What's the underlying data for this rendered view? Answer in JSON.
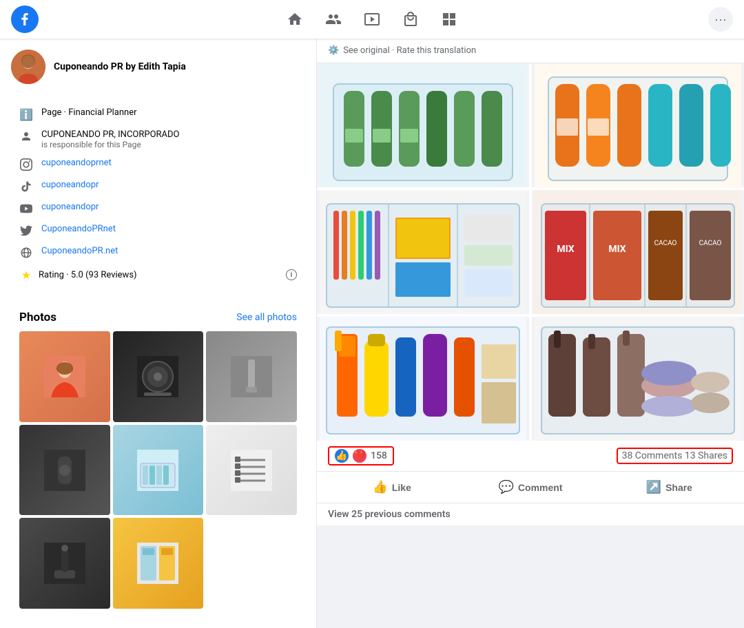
{
  "nav": {
    "logo_letter": "f",
    "icons": [
      "home",
      "people",
      "video",
      "store",
      "grid"
    ]
  },
  "sidebar": {
    "page_name": "Cuponeando PR by Edith Tapia",
    "page_type": "Page · Financial Planner",
    "responsible_entity": "CUPONEANDO PR, INCORPORADO",
    "responsible_sub": "is responsible for this Page",
    "instagram": "cuponeandoprnet",
    "tiktok": "cuponeandopr",
    "youtube": "cuponeandopr",
    "twitter": "CuponeandoPRnet",
    "website": "CuponeandoPR.net",
    "rating_label": "Rating · 5.0 (93 Reviews)",
    "photos_title": "Photos",
    "see_all_photos": "See all photos"
  },
  "post": {
    "translation_text": "See original · Rate this translation",
    "reactions_count": "158",
    "comments_shares": "38 Comments  13 Shares",
    "like_label": "Like",
    "comment_label": "Comment",
    "share_label": "Share",
    "view_comments": "View 25 previous comments"
  },
  "colors": {
    "blue": "#1877f2",
    "red": "#f33e58",
    "border_red": "#ff0000",
    "gray": "#65676b",
    "light_bg": "#f0f2f5"
  }
}
